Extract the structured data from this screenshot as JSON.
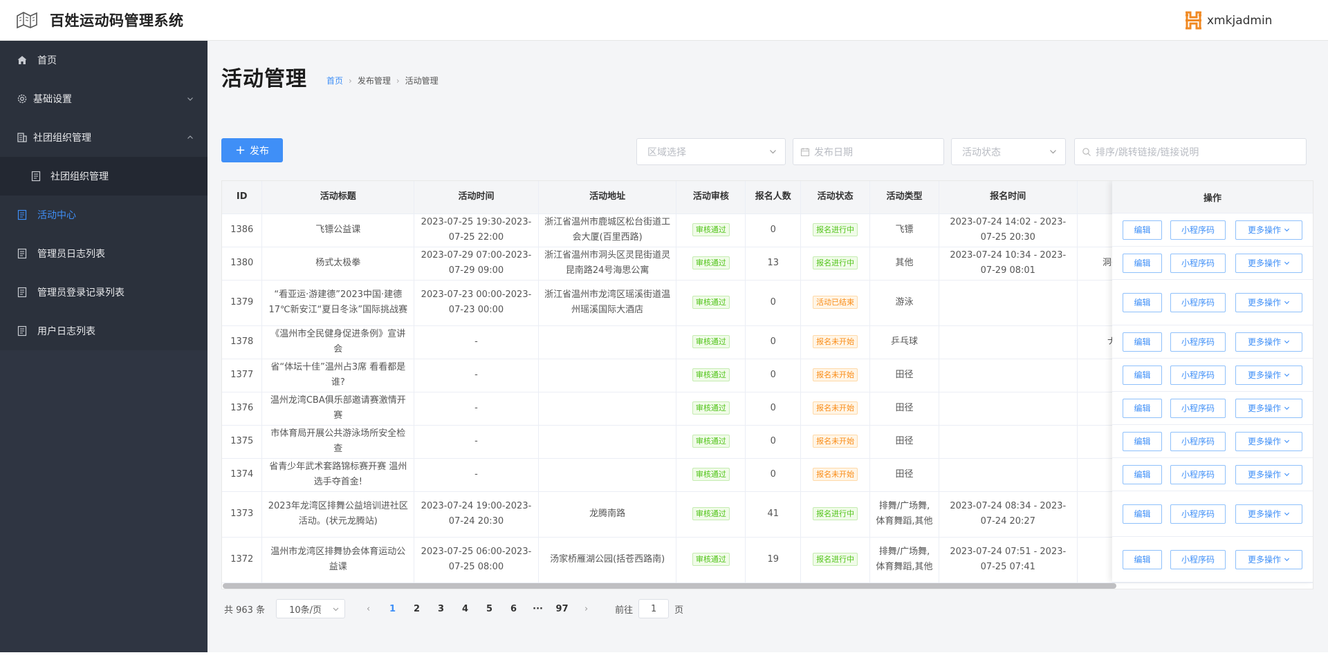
{
  "header": {
    "title": "百姓运动码管理系统",
    "username": "xmkjadmin"
  },
  "sidebar": {
    "items": [
      {
        "label": "首页",
        "icon": "home-icon"
      },
      {
        "label": "基础设置",
        "icon": "gear-icon"
      },
      {
        "label": "社团组织管理",
        "icon": "building-icon"
      },
      {
        "label": "社团组织管理",
        "icon": "document-icon"
      },
      {
        "label": "活动中心",
        "icon": "document-icon"
      },
      {
        "label": "管理员日志列表",
        "icon": "document-icon"
      },
      {
        "label": "管理员登录记录列表",
        "icon": "document-icon"
      },
      {
        "label": "用户日志列表",
        "icon": "document-icon"
      }
    ]
  },
  "page": {
    "title": "活动管理",
    "breadcrumb": [
      "首页",
      "发布管理",
      "活动管理"
    ],
    "publish_label": "发布",
    "filters": {
      "region": "区域选择",
      "date": "发布日期",
      "status": "活动状态",
      "search": "排序/跳转链接/链接说明"
    }
  },
  "table": {
    "headers": [
      "ID",
      "活动标题",
      "活动时间",
      "活动地址",
      "活动审核",
      "报名人数",
      "活动状态",
      "活动类型",
      "报名时间",
      "",
      "操作"
    ],
    "rows": [
      {
        "id": "1386",
        "title": "飞镖公益课",
        "time": "2023-07-25 19:30-2023-07-25 22:00",
        "addr": "浙江省温州市鹿城区松台街道工会大厦(百里西路)",
        "audit": "审核通过",
        "count": "0",
        "status": "报名进行中",
        "type": "飞镖",
        "signup": "2023-07-24 14:02 - 2023-07-25 20:30",
        "extra": ""
      },
      {
        "id": "1380",
        "title": "杨式太极拳",
        "time": "2023-07-29 07:00-2023-07-29 09:00",
        "addr": "浙江省温州市洞头区灵昆街道灵昆南路24号海思公寓",
        "audit": "审核通过",
        "count": "13",
        "status": "报名进行中",
        "type": "其他",
        "signup": "2023-07-24 10:34 - 2023-07-29 08:01",
        "extra": "洞头"
      },
      {
        "id": "1379",
        "title": "“看亚运·游建德”2023中国·建德17℃新安江“夏日冬泳”国际挑战赛",
        "time": "2023-07-23 00:00-2023-07-23 00:00",
        "addr": "浙江省温州市龙湾区瑶溪街道温州瑶溪国际大酒店",
        "audit": "审核通过",
        "count": "0",
        "status": "活动已结束",
        "type": "游泳",
        "signup": "",
        "extra": ""
      },
      {
        "id": "1378",
        "title": "《温州市全民健身促进条例》宣讲会",
        "time": "-",
        "addr": "",
        "audit": "审核通过",
        "count": "0",
        "status": "报名未开始",
        "type": "乒乓球",
        "signup": "",
        "extra": "ナ"
      },
      {
        "id": "1377",
        "title": "省“体坛十佳”温州占3席 看看都是谁?",
        "time": "-",
        "addr": "",
        "audit": "审核通过",
        "count": "0",
        "status": "报名未开始",
        "type": "田径",
        "signup": "",
        "extra": ""
      },
      {
        "id": "1376",
        "title": "温州龙湾CBA俱乐部邀请赛激情开赛",
        "time": "-",
        "addr": "",
        "audit": "审核通过",
        "count": "0",
        "status": "报名未开始",
        "type": "田径",
        "signup": "",
        "extra": ""
      },
      {
        "id": "1375",
        "title": "市体育局开展公共游泳场所安全检查",
        "time": "-",
        "addr": "",
        "audit": "审核通过",
        "count": "0",
        "status": "报名未开始",
        "type": "田径",
        "signup": "",
        "extra": ""
      },
      {
        "id": "1374",
        "title": "省青少年武术套路锦标赛开赛 温州选手夺首金!",
        "time": "-",
        "addr": "",
        "audit": "审核通过",
        "count": "0",
        "status": "报名未开始",
        "type": "田径",
        "signup": "",
        "extra": ""
      },
      {
        "id": "1373",
        "title": "2023年龙湾区排舞公益培训进社区活动。(状元龙腾站)",
        "time": "2023-07-24 19:00-2023-07-24 20:30",
        "addr": "龙腾南路",
        "audit": "审核通过",
        "count": "41",
        "status": "报名进行中",
        "type": "排舞/广场舞,体育舞蹈,其他",
        "signup": "2023-07-24 08:34 - 2023-07-24 20:27",
        "extra": ""
      },
      {
        "id": "1372",
        "title": "温州市龙湾区排舞协会体育运动公益课",
        "time": "2023-07-25 06:00-2023-07-25 08:00",
        "addr": "汤家桥雁湖公园(括苍西路南)",
        "audit": "审核通过",
        "count": "19",
        "status": "报名进行中",
        "type": "排舞/广场舞,体育舞蹈,其他",
        "signup": "2023-07-24 07:51 - 2023-07-25 07:41",
        "extra": ""
      }
    ],
    "ops": {
      "edit": "编辑",
      "code": "小程序码",
      "more": "更多操作"
    }
  },
  "pagination": {
    "total": "共 963 条",
    "page_size": "10条/页",
    "pages": [
      "1",
      "2",
      "3",
      "4",
      "5",
      "6",
      "···",
      "97"
    ],
    "goto_prefix": "前往",
    "goto_value": "1",
    "goto_suffix": "页"
  },
  "colors": {
    "accent": "#3f8ff7",
    "sidebar": "#2f3542",
    "success": "#52c41a",
    "warning": "#fa8c16"
  }
}
